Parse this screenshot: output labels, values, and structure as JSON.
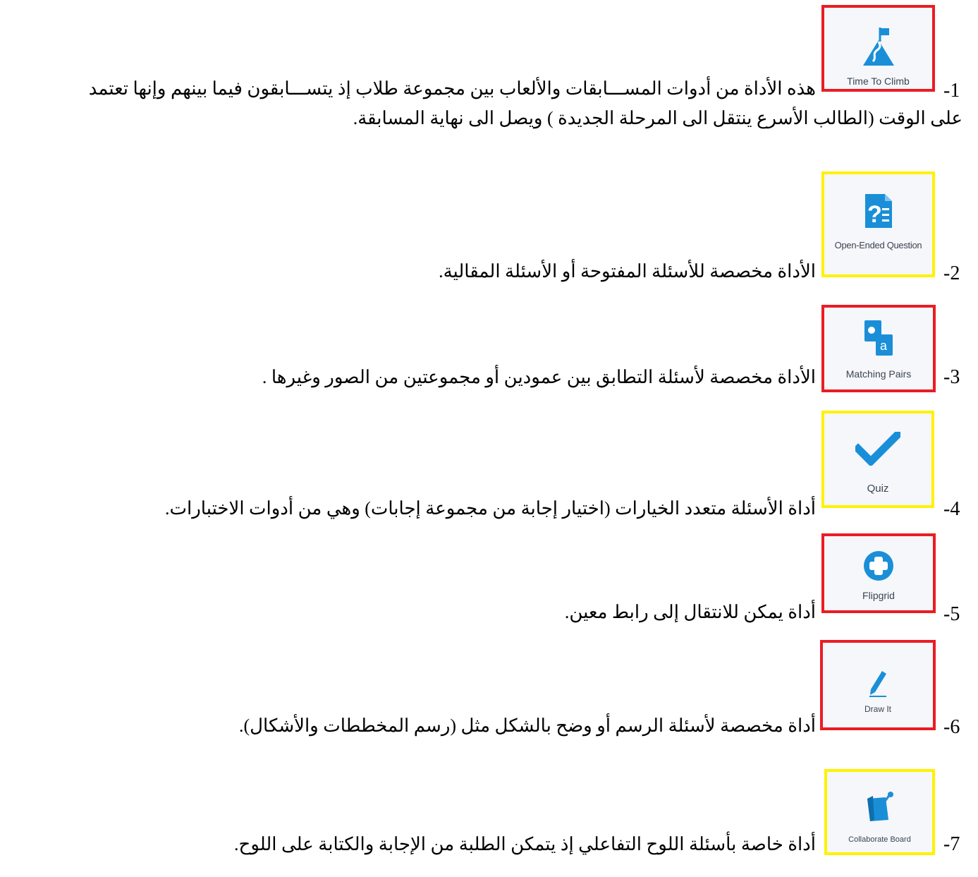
{
  "accent_colors": {
    "red_frame": "#ea1c24",
    "yellow_frame": "#fff200",
    "icon_blue": "#1a8fd8"
  },
  "items": [
    {
      "number": "-1",
      "text_line1": "هذه الأداة من أدوات المســـابقات والألعاب بين مجموعة طلاب إذ يتســـابقون فيما بينهم وإنها تعتمد",
      "text_line2": "على الوقت (الطالب الأسرع ينتقل الى المرحلة الجديدة ) ويصل الى نهاية المسابقة.",
      "tool_label": "Time To Climb",
      "icon": "mountain-flag-icon",
      "frame": "red"
    },
    {
      "number": "-2",
      "text_line1": "الأداة مخصصة للأسئلة المفتوحة أو الأسئلة المقالية.",
      "tool_label": "Open-Ended Question",
      "icon": "question-document-icon",
      "frame": "yellow"
    },
    {
      "number": "-3",
      "text_line1": "الأداة مخصصة لأسئلة التطابق بين عمودين أو مجموعتين من الصور وغيرها .",
      "tool_label": "Matching Pairs",
      "icon": "matching-cards-icon",
      "frame": "red"
    },
    {
      "number": "-4",
      "text_line1": "أداة الأسئلة متعدد الخيارات (اختيار إجابة من مجموعة إجابات) وهي من أدوات الاختبارات.",
      "tool_label": "Quiz",
      "icon": "checkmark-icon",
      "frame": "yellow"
    },
    {
      "number": "-5",
      "text_line1": "أداة يمكن للانتقال إلى رابط معين.",
      "tool_label": "Flipgrid",
      "icon": "plus-circle-icon",
      "frame": "red"
    },
    {
      "number": "-6",
      "text_line1": "أداة مخصصة لأسئلة الرسم أو وضح بالشكل مثل (رسم المخططات والأشكال).",
      "tool_label": "Draw It",
      "icon": "pencil-icon",
      "frame": "red"
    },
    {
      "number": "-7",
      "text_line1": "أداة خاصة بأسئلة اللوح التفاعلي إذ يتمكن الطلبة من الإجابة والكتابة على اللوح.",
      "tool_label": "Collaborate Board",
      "icon": "board-pin-icon",
      "frame": "yellow"
    }
  ]
}
